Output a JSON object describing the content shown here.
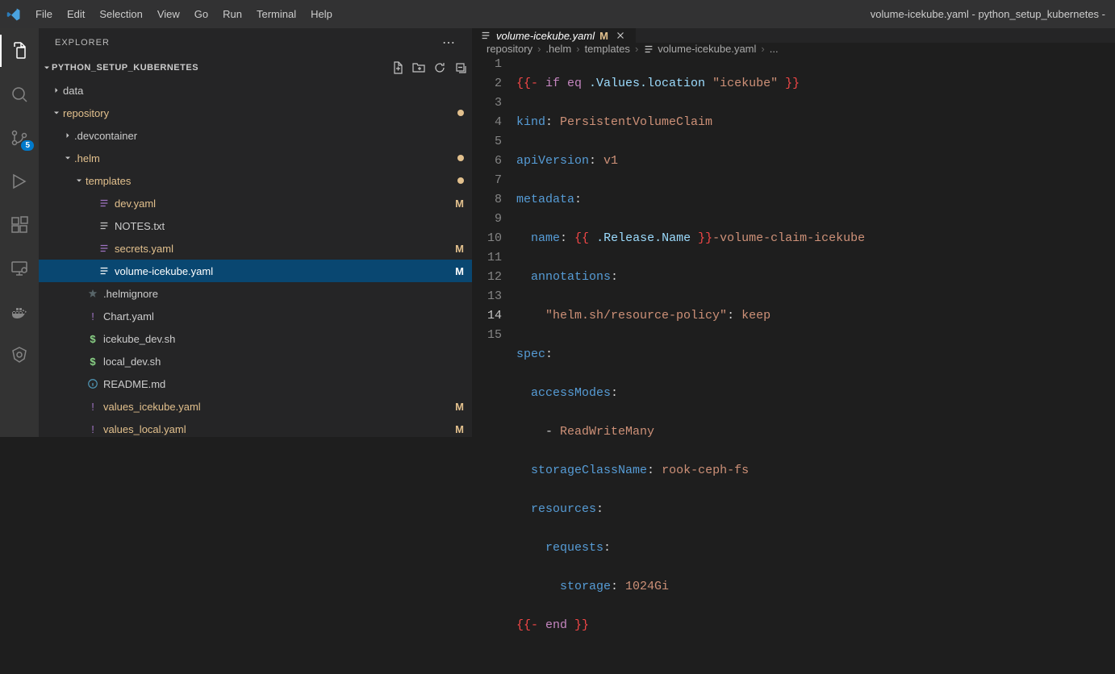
{
  "window_title": "volume-icekube.yaml - python_setup_kubernetes -",
  "menu": [
    "File",
    "Edit",
    "Selection",
    "View",
    "Go",
    "Run",
    "Terminal",
    "Help"
  ],
  "scm_badge": "5",
  "explorer": {
    "title": "EXPLORER",
    "section": "PYTHON_SETUP_KUBERNETES"
  },
  "tree": {
    "data": "data",
    "repository": "repository",
    "devcontainer": ".devcontainer",
    "helm": ".helm",
    "templates": "templates",
    "dev_yaml": "dev.yaml",
    "notes_txt": "NOTES.txt",
    "secrets_yaml": "secrets.yaml",
    "volume_icekube_yaml": "volume-icekube.yaml",
    "helmignore": ".helmignore",
    "chart_yaml": "Chart.yaml",
    "icekube_dev_sh": "icekube_dev.sh",
    "local_dev_sh": "local_dev.sh",
    "readme_md": "README.md",
    "values_icekube_yaml": "values_icekube.yaml",
    "values_local_yaml": "values_local.yaml",
    "status_M": "M"
  },
  "tab": {
    "name": "volume-icekube.yaml",
    "status": "M"
  },
  "breadcrumbs": {
    "repository": "repository",
    "helm": ".helm",
    "templates": "templates",
    "file": "volume-icekube.yaml",
    "more": "..."
  },
  "lines": [
    "1",
    "2",
    "3",
    "4",
    "5",
    "6",
    "7",
    "8",
    "9",
    "10",
    "11",
    "12",
    "13",
    "14",
    "15"
  ],
  "code": {
    "l1": {
      "open": "{{-",
      "if": " if eq ",
      "vals": ".Values.location",
      "str": " \"icekube\" ",
      "close": "}}"
    },
    "l2": {
      "k": "kind",
      "v": "PersistentVolumeClaim"
    },
    "l3": {
      "k": "apiVersion",
      "v": "v1"
    },
    "l4": {
      "k": "metadata"
    },
    "l5": {
      "k": "name",
      "open": "{{",
      "var": " .Release.Name ",
      "close": "}}",
      "suffix": "-volume-claim-icekube"
    },
    "l6": {
      "k": "annotations"
    },
    "l7": {
      "k": "\"helm.sh/resource-policy\"",
      "v": "keep"
    },
    "l8": {
      "k": "spec"
    },
    "l9": {
      "k": "accessModes"
    },
    "l10": {
      "dash": "- ",
      "v": "ReadWriteMany"
    },
    "l11": {
      "k": "storageClassName",
      "v": "rook-ceph-fs"
    },
    "l12": {
      "k": "resources"
    },
    "l13": {
      "k": "requests"
    },
    "l14": {
      "k": "storage",
      "v": "1024Gi"
    },
    "l15": {
      "open": "{{-",
      "end": " end ",
      "close": "}}"
    }
  }
}
